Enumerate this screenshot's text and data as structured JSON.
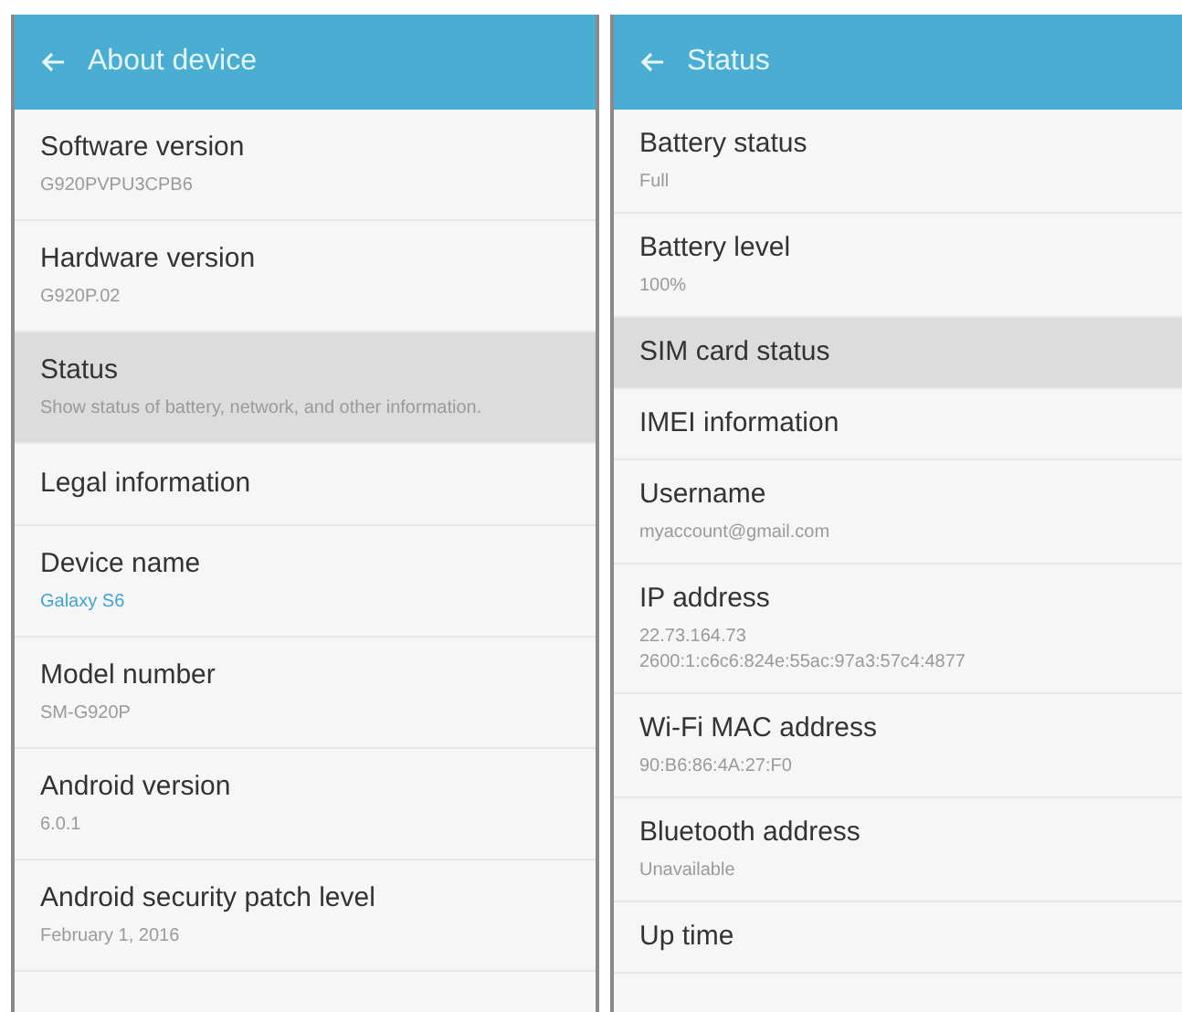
{
  "panels": [
    {
      "title": "About device",
      "items": [
        {
          "title": "Software version",
          "summary": "G920PVPU3CPB6",
          "kind": "plain",
          "selected": false
        },
        {
          "title": "Hardware version",
          "summary": "G920P.02",
          "kind": "plain",
          "selected": false
        },
        {
          "title": "Status",
          "summary": "Show status of battery, network, and other information.",
          "kind": "plain",
          "selected": true
        },
        {
          "title": "Legal information",
          "selected": false
        },
        {
          "title": "Device name",
          "summary": "Galaxy S6",
          "kind": "link",
          "selected": false
        },
        {
          "title": "Model number",
          "summary": "SM-G920P",
          "kind": "plain",
          "selected": false
        },
        {
          "title": "Android version",
          "summary": "6.0.1",
          "kind": "plain",
          "selected": false
        },
        {
          "title": "Android security patch level",
          "summary": "February 1, 2016",
          "kind": "plain",
          "selected": false
        }
      ]
    },
    {
      "title": "Status",
      "items": [
        {
          "title": "Battery status",
          "summary": "Full",
          "kind": "plain",
          "selected": false
        },
        {
          "title": "Battery level",
          "summary": "100%",
          "kind": "plain",
          "selected": false
        },
        {
          "title": "SIM card status",
          "selected": true
        },
        {
          "title": "IMEI information",
          "selected": false
        },
        {
          "title": "Username",
          "summary": "myaccount@gmail.com",
          "kind": "plain",
          "selected": false
        },
        {
          "title": "IP address",
          "summary": "22.73.164.73\n2600:1:c6c6:824e:55ac:97a3:57c4:4877",
          "kind": "plain",
          "selected": false
        },
        {
          "title": "Wi-Fi MAC address",
          "summary": "90:B6:86:4A:27:F0",
          "kind": "plain",
          "selected": false
        },
        {
          "title": "Bluetooth address",
          "summary": "Unavailable",
          "kind": "plain",
          "selected": false
        },
        {
          "title": "Up time",
          "selected": false
        }
      ]
    }
  ]
}
